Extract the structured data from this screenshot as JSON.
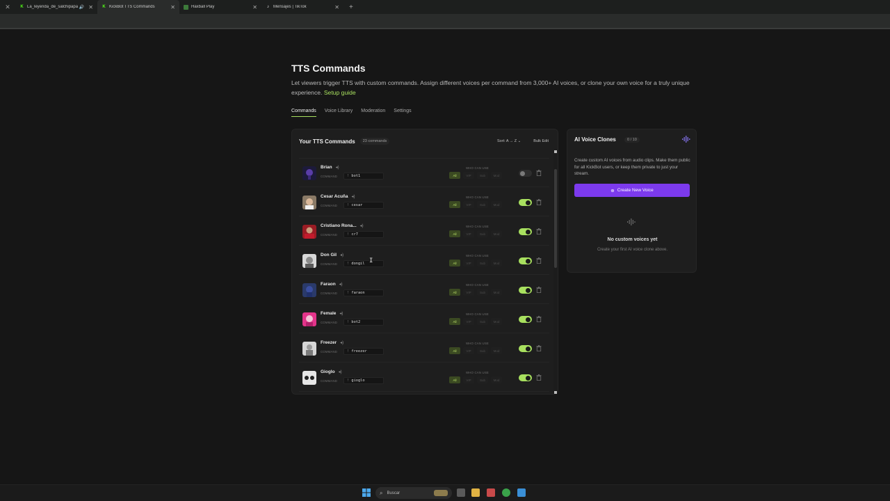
{
  "browser": {
    "tabs": [
      {
        "title": "La_leyenda_de_salchipapa",
        "favicon": "kick-icon",
        "audio": true,
        "active": false
      },
      {
        "title": "KickBot TTS Commands",
        "favicon": "kickbot-icon",
        "audio": false,
        "active": true
      },
      {
        "title": "Haxball Play",
        "favicon": "haxball-icon",
        "audio": false,
        "active": false
      },
      {
        "title": "Mensajes | TikTok",
        "favicon": "tiktok-icon",
        "audio": false,
        "active": false
      }
    ]
  },
  "page": {
    "title": "TTS Commands",
    "description": "Let viewers trigger TTS with custom commands. Assign different voices per command from 3,000+ AI voices, or clone your own voice for a truly unique experience.",
    "setup_link": "Setup guide",
    "tabs": [
      "Commands",
      "Voice Library",
      "Moderation",
      "Settings"
    ],
    "active_tab": "Commands"
  },
  "commands_panel": {
    "title": "Your TTS Commands",
    "count_label": "23 commands",
    "sort_label": "Sort: A → Z",
    "bulk_label": "Bulk Edit",
    "command_label": "COMMAND",
    "who_can_use_label": "WHO CAN USE",
    "perm_labels": [
      "All",
      "VIP",
      "Sub",
      "Mod"
    ],
    "rows": [
      {
        "name": "Brian",
        "command": "bot1",
        "enabled": false,
        "avatar": "brian"
      },
      {
        "name": "Cesar Acuña",
        "command": "cesar",
        "enabled": true,
        "avatar": "cesar"
      },
      {
        "name": "Cristiano Rona...",
        "command": "cr7",
        "enabled": true,
        "avatar": "cr7"
      },
      {
        "name": "Don Gil",
        "command": "dongil",
        "enabled": true,
        "avatar": "dongil"
      },
      {
        "name": "Faraon",
        "command": "faraon",
        "enabled": true,
        "avatar": "faraon"
      },
      {
        "name": "Female",
        "command": "bot2",
        "enabled": true,
        "avatar": "female"
      },
      {
        "name": "Freezer",
        "command": "freezer",
        "enabled": true,
        "avatar": "freezer"
      },
      {
        "name": "Gioglo",
        "command": "gioglo",
        "enabled": true,
        "avatar": "gioglo"
      }
    ]
  },
  "clones_panel": {
    "title": "AI Voice Clones",
    "quota": "0 / 10",
    "description": "Create custom AI voices from audio clips. Make them public for all KickBot users, or keep them private to just your stream.",
    "button_label": "Create New Voice",
    "empty_title": "No custom voices yet",
    "empty_subtitle": "Create your first AI voice clone above."
  },
  "taskbar": {
    "search_placeholder": "Buscar"
  },
  "colors": {
    "accent": "#a8e05f",
    "primary_button": "#7c3aed",
    "background": "#161616",
    "panel": "#1e1e1e"
  }
}
